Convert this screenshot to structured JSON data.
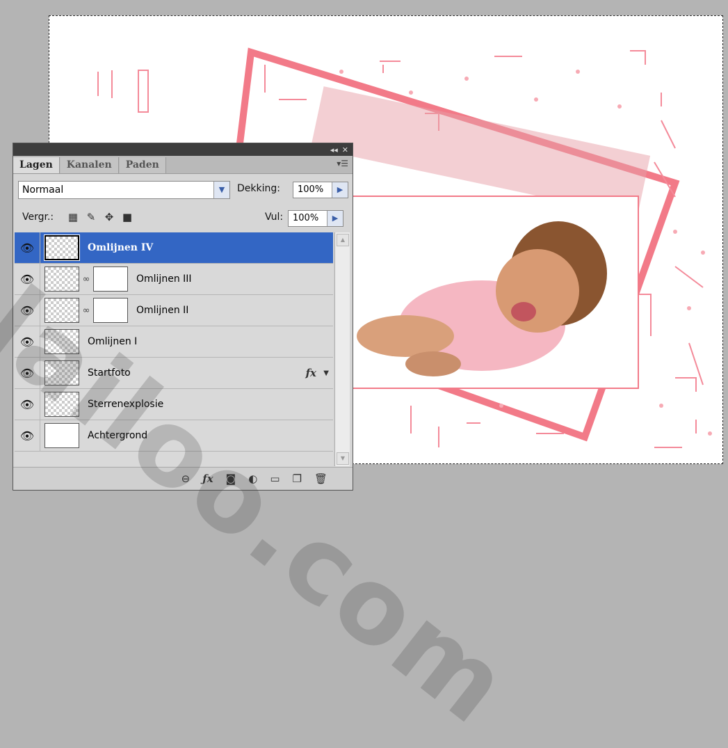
{
  "canvas": {
    "accent_color": "#f27a88"
  },
  "watermark": {
    "text": "lailoo.com"
  },
  "panel": {
    "tabs": [
      {
        "label": "Lagen"
      },
      {
        "label": "Kanalen"
      },
      {
        "label": "Paden"
      }
    ],
    "blend_mode": "Normaal",
    "opacity_label": "Dekking:",
    "opacity_value": "100%",
    "lock_label": "Vergr.:",
    "fill_label": "Vul:",
    "fill_value": "100%",
    "layers": [
      {
        "name": "Omlijnen IV",
        "selected": true
      },
      {
        "name": "Omlijnen III",
        "mask": true
      },
      {
        "name": "Omlijnen II",
        "mask": true
      },
      {
        "name": "Omlijnen I"
      },
      {
        "name": "Startfoto",
        "fx": "fx"
      },
      {
        "name": "Sterrenexplosie"
      },
      {
        "name": "Achtergrond"
      }
    ],
    "selected_color": "#3366c4"
  }
}
